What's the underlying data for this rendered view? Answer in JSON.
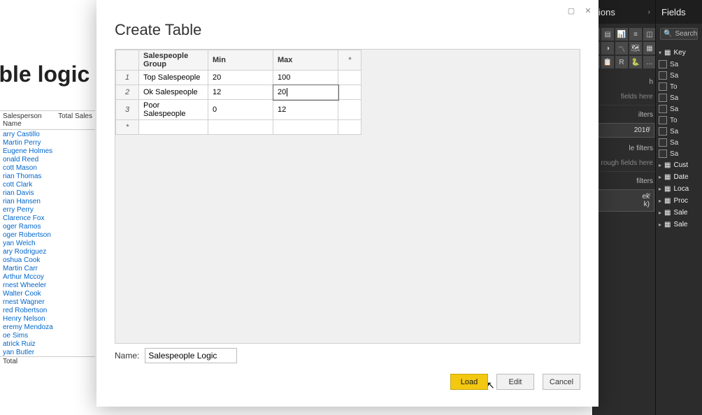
{
  "header": {
    "viz_label": "ions",
    "fields_label": "Fields",
    "search_placeholder": "Search"
  },
  "canvas_title_fragment": "table logic",
  "bg_table": {
    "col1": "Salesperson Name",
    "col2": "Total Sales",
    "rows": [
      "arry Castillo",
      "Martin Perry",
      "Eugene Holmes",
      "onald Reed",
      "cott Mason",
      "rian Thomas",
      "cott Clark",
      "rian Davis",
      "rian Hansen",
      "erry Perry",
      "Clarence Fox",
      "oger Ramos",
      "oger Robertson",
      "yan Welch",
      "ary Rodriguez",
      "oshua Cook",
      "Martin Carr",
      "Arthur Mccoy",
      "rnest Wheeler",
      "Walter Cook",
      "rnest Wagner",
      "red Robertson",
      "Henry Nelson",
      "eremy Mendoza",
      "oe Sims",
      "atrick Ruiz",
      "yan Butler"
    ],
    "total_label": "Total"
  },
  "viz_icons": [
    "▦",
    "▤",
    "📊",
    "≡",
    "◫",
    "◐",
    "◑",
    "〽",
    "🗺",
    "▦",
    "≡",
    "📋",
    "R",
    "🐍",
    "…"
  ],
  "viz_hints": {
    "title_suffix": "h",
    "values_hint": "fields here",
    "page_filters": "ilters",
    "filter_chip1": "2016",
    "report_filters": "le filters",
    "drillthrough": "rough fields here",
    "more_filters": "filters",
    "filter_chip2a": "ek",
    "filter_chip2b": "k)"
  },
  "fields_tables": {
    "expanded_label": "Key",
    "expanded_items": [
      "Sa",
      "Sa",
      "To",
      "Sa",
      "Sa",
      "To",
      "Sa",
      "Sa",
      "Sa"
    ],
    "collapsed": [
      "Cust",
      "Date",
      "Loca",
      "Proc",
      "Sale",
      "Sale"
    ]
  },
  "modal": {
    "title": "Create Table",
    "columns": [
      "Salespeople Group",
      "Min",
      "Max"
    ],
    "rows": [
      {
        "n": "1",
        "group": "Top Salespeople",
        "min": "20",
        "max": "100"
      },
      {
        "n": "2",
        "group": "Ok Salespeople",
        "min": "12",
        "max": "20"
      },
      {
        "n": "3",
        "group": "Poor Salespeople",
        "min": "0",
        "max": "12"
      }
    ],
    "name_label": "Name:",
    "name_value": "Salespeople Logic",
    "buttons": {
      "load": "Load",
      "edit": "Edit",
      "cancel": "Cancel"
    }
  }
}
